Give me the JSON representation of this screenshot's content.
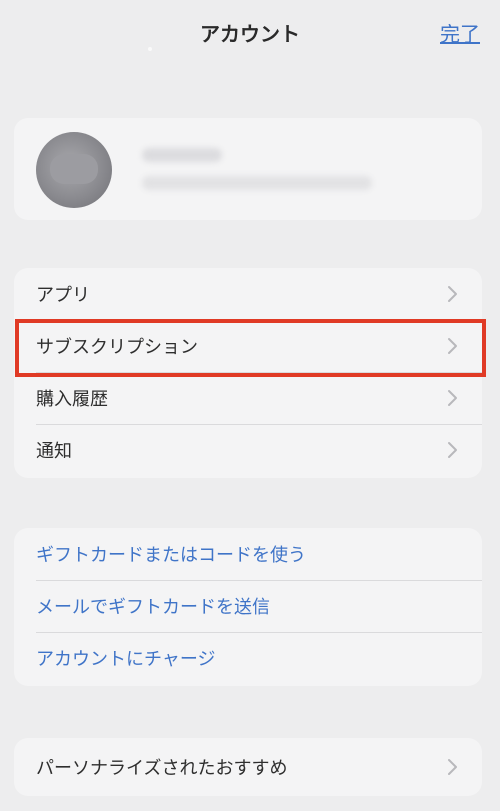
{
  "header": {
    "title": "アカウント",
    "done_label": "完了"
  },
  "profile": {
    "name_redacted": true,
    "email_redacted": true
  },
  "menu": {
    "items": [
      {
        "label": "アプリ"
      },
      {
        "label": "サブスクリプション"
      },
      {
        "label": "購入履歴"
      },
      {
        "label": "通知"
      }
    ]
  },
  "gift": {
    "items": [
      {
        "label": "ギフトカードまたはコードを使う"
      },
      {
        "label": "メールでギフトカードを送信"
      },
      {
        "label": "アカウントにチャージ"
      }
    ]
  },
  "bottom": {
    "personalized_label": "パーソナライズされたおすすめ"
  },
  "colors": {
    "background": "#ededee",
    "card": "#f4f4f5",
    "link": "#3f74c8",
    "highlight": "#e03a25"
  },
  "icons": {
    "chevron": "chevron-right-icon",
    "avatar": "avatar"
  }
}
